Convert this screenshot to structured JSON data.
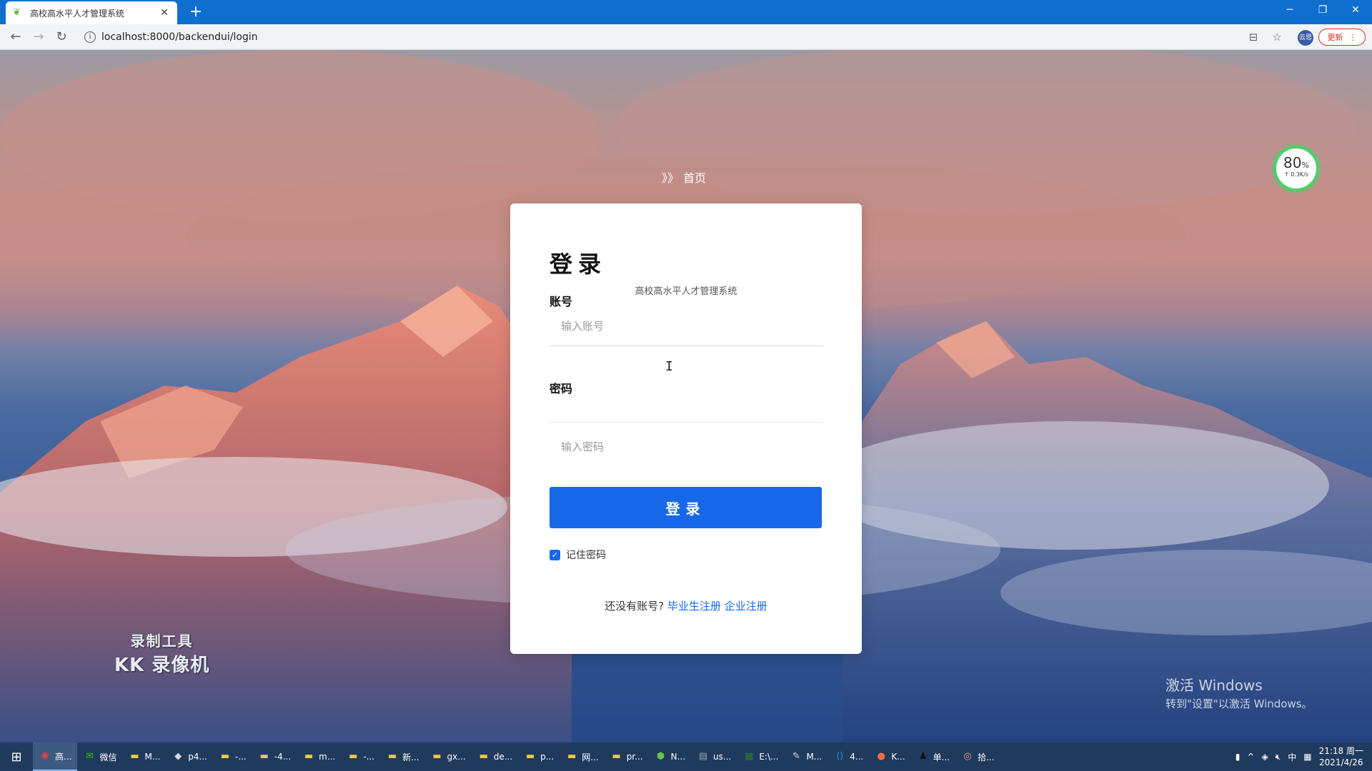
{
  "browser": {
    "tab_title": "高校高水平人才管理系统",
    "url": "localhost:8000/backendui/login",
    "update_label": "更新",
    "profile_label": "云思"
  },
  "page": {
    "breadcrumb_arrows": "》》",
    "breadcrumb_home": "首页"
  },
  "login": {
    "title": "登录",
    "subtitle": "高校高水平人才管理系统",
    "account_label": "账号",
    "account_placeholder": "输入账号",
    "password_label": "密码",
    "password_placeholder": "输入密码",
    "submit_label": "登录",
    "remember_label": "记住密码",
    "remember_checked": true,
    "register_prompt": "还没有账号?",
    "register_graduate": "毕业生注册",
    "register_company": "企业注册"
  },
  "overlays": {
    "speed_percent": "80",
    "speed_percent_unit": "%",
    "speed_rate": "↑ 0.3K/s",
    "watermark_line1": "录制工具",
    "watermark_line2": "KK 录像机",
    "activate_title": "激活 Windows",
    "activate_hint": "转到\"设置\"以激活 Windows。"
  },
  "taskbar": {
    "items": [
      {
        "label": "高...",
        "icon": "chrome-icon",
        "color": "#e8453c",
        "active": true
      },
      {
        "label": "微信",
        "icon": "wechat-icon",
        "color": "#2dc100",
        "active": false
      },
      {
        "label": "M...",
        "icon": "folder-icon",
        "color": "#f3c644",
        "active": false
      },
      {
        "label": "p4...",
        "icon": "app-icon",
        "color": "#cfd8dc",
        "active": false
      },
      {
        "label": "-...",
        "icon": "folder-icon",
        "color": "#f3c644",
        "active": false
      },
      {
        "label": "-4...",
        "icon": "folder-icon",
        "color": "#f3c644",
        "active": false
      },
      {
        "label": "m...",
        "icon": "folder-icon",
        "color": "#f3c644",
        "active": false
      },
      {
        "label": "-...",
        "icon": "folder-icon",
        "color": "#f3c644",
        "active": false
      },
      {
        "label": "新...",
        "icon": "folder-icon",
        "color": "#f3c644",
        "active": false
      },
      {
        "label": "gx...",
        "icon": "folder-icon",
        "color": "#f3c644",
        "active": false
      },
      {
        "label": "de...",
        "icon": "folder-icon",
        "color": "#f3c644",
        "active": false
      },
      {
        "label": "p...",
        "icon": "folder-icon",
        "color": "#f3c644",
        "active": false
      },
      {
        "label": "网...",
        "icon": "folder-icon",
        "color": "#f3c644",
        "active": false
      },
      {
        "label": "pr...",
        "icon": "folder-icon",
        "color": "#f3c644",
        "active": false
      },
      {
        "label": "N...",
        "icon": "node-icon",
        "color": "#6cc24a",
        "active": false
      },
      {
        "label": "us...",
        "icon": "window-icon",
        "color": "#90a4ae",
        "active": false
      },
      {
        "label": "E:\\...",
        "icon": "sheet-icon",
        "color": "#2e7d32",
        "active": false
      },
      {
        "label": "M...",
        "icon": "pen-icon",
        "color": "#cfd8dc",
        "active": false
      },
      {
        "label": "4...",
        "icon": "vscode-icon",
        "color": "#2196f3",
        "active": false
      },
      {
        "label": "K...",
        "icon": "recorder-icon",
        "color": "#ff7043",
        "active": false
      },
      {
        "label": "单...",
        "icon": "qq-icon",
        "color": "#111111",
        "active": false
      },
      {
        "label": "拾...",
        "icon": "capture-icon",
        "color": "#ef9a9a",
        "active": false
      }
    ],
    "input_method": "中",
    "time": "21:18 周一",
    "date": "2021/4/26"
  }
}
